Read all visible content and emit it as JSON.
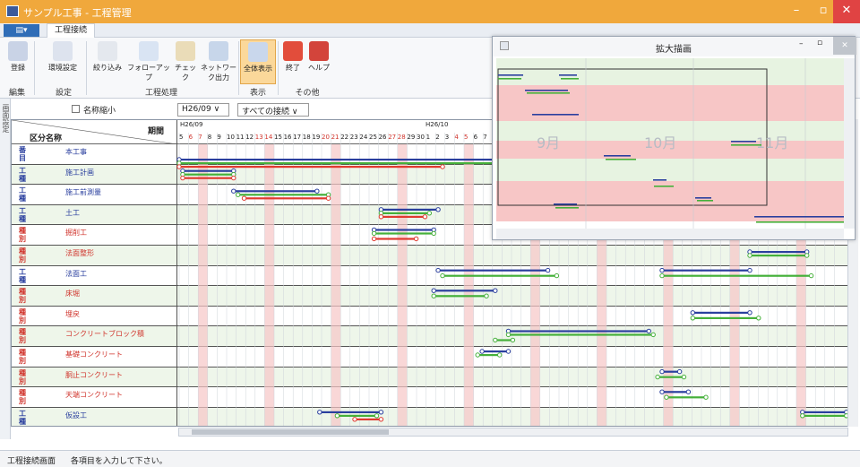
{
  "window": {
    "title": "サンプル工事 - 工程管理"
  },
  "menu": {
    "tab": "工程接続"
  },
  "ribbon": {
    "buttons": [
      {
        "label": "登録"
      },
      {
        "label": "環境設定"
      },
      {
        "label": "絞り込み"
      },
      {
        "label": "フォローアップ"
      },
      {
        "label": "チェック"
      },
      {
        "label": "ネットワーク出力"
      },
      {
        "label": "全体表示"
      },
      {
        "label": "終了"
      },
      {
        "label": "ヘルプ"
      }
    ],
    "groups": {
      "edit": "編集",
      "settings": "設定",
      "process": "工程処理",
      "view": "表示",
      "other": "その他"
    }
  },
  "sidebar": {
    "label": "画面設定"
  },
  "toolbar2": {
    "shrink_label": "名称縮小",
    "period_value": "H26/09",
    "filter_value": "すべての接続"
  },
  "grid": {
    "header": {
      "col1": "区分名称",
      "col2": "期間",
      "month1": "H26/09",
      "month2": "H26/10",
      "days": [
        "5",
        "6",
        "7",
        "8",
        "9",
        "10",
        "11",
        "12",
        "13",
        "14",
        "15",
        "16",
        "17",
        "18",
        "19",
        "20",
        "21",
        "22",
        "23",
        "24",
        "25",
        "26",
        "27",
        "28",
        "29",
        "30",
        "1",
        "2",
        "3",
        "4",
        "5",
        "6",
        "7"
      ]
    },
    "rows": [
      {
        "kind": "番目",
        "name": "本工事",
        "color": "#2a3f9e"
      },
      {
        "kind": "工種",
        "name": "施工計画",
        "color": "#2a3f9e"
      },
      {
        "kind": "工種",
        "name": "施工前測量",
        "color": "#2a3f9e"
      },
      {
        "kind": "工種",
        "name": "土工",
        "color": "#2a3f9e"
      },
      {
        "kind": "種別",
        "name": "掘削工",
        "color": "#d0342c"
      },
      {
        "kind": "種別",
        "name": "法面整形",
        "color": "#d0342c"
      },
      {
        "kind": "工種",
        "name": "法面工",
        "color": "#2a3f9e"
      },
      {
        "kind": "種別",
        "name": "床堀",
        "color": "#d0342c"
      },
      {
        "kind": "種別",
        "name": "埋戻",
        "color": "#d0342c"
      },
      {
        "kind": "種別",
        "name": "コンクリートブロック積",
        "color": "#d0342c"
      },
      {
        "kind": "種別",
        "name": "基礎コンクリート",
        "color": "#d0342c"
      },
      {
        "kind": "種別",
        "name": "胴止コンクリート",
        "color": "#d0342c"
      },
      {
        "kind": "種別",
        "name": "天端コンクリート",
        "color": "#d0342c"
      },
      {
        "kind": "工種",
        "name": "仮設工",
        "color": "#2a3f9e"
      }
    ]
  },
  "popup": {
    "title": "拡大描画",
    "months": [
      "9月",
      "10月",
      "11月"
    ]
  },
  "status": {
    "left": "工程接続画面",
    "message": "各項目を入力して下さい。"
  },
  "colors": {
    "accent": "#f0a83c",
    "plan": "#2a3f9e",
    "actual": "#45b03a",
    "late": "#e03a30",
    "holiday": "#f7c6c6",
    "rowbg": "#e7f3e1"
  }
}
